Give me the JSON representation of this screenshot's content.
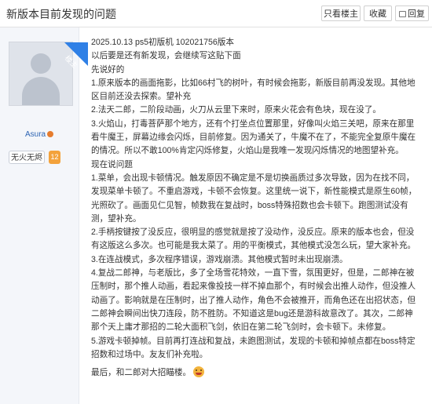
{
  "header": {
    "title": "新版本目前发现的问题",
    "only_op_label": "只看楼主",
    "favorite_label": "收藏",
    "reply_label": "回复"
  },
  "author": {
    "op_badge": "楼主",
    "username": "Asura",
    "title_badge": "无火无烬",
    "level": "12"
  },
  "post": {
    "lines": [
      "2025.10.13 ps5初版机 102021756版本",
      "以后要是还有新发现，会继续写这贴下面",
      "先说好的",
      "1.原来版本的画面拖影，比如66村飞的树叶，有时候会拖影，新版目前再没发现。其他地区目前还没去探索。望补充",
      "2.法天二郎，二阶段动画，火刀从云里下来时，原来火花会有色块，现在没了。",
      "3.火焰山，打毒菩萨那个地方，还有个打坐点位置那里，好像叫火焰三关吧，原来在那里看牛魔王，屏幕边缘会闪烁，目前修复。因为通关了，牛魔不在了，不能完全复原牛魔在的情况。所以不敢100%肯定闪烁修复，火焰山是我唯一发现闪烁情况的地图望补充。",
      "现在说问题",
      "1.菜单，会出现卡顿情况。触发原因不确定是不是切换画质过多次导致，因为在找不同，发现菜单卡顿了。不重启游戏，卡顿不会恢复。这里统一说下，新性能模式是原生60帧，光照砍了。画面见仁见智，帧数我在复战时，boss特殊招数也会卡顿下。跑图测试没有测，望补充。",
      "2.手柄按键按了没反应，很明显的感觉就是按了没动作，没反应。原来的版本也会，但没有这版这么多次。也可能是我太菜了。用的平衡模式，其他模式没怎么玩，望大家补充。",
      "3.在连战模式，多次程序错误，游戏崩溃。其他模式暂时未出现崩溃。",
      "4.复战二郎神，与老版比，多了全场雪花特效，一直下雪，氛围更好，但是，二郎神在被压制时，那个推人动画，看起来像投技一样不掉血那个，有时候会出推人动作，但没推人动画了。影响就是在压制时，出了推人动作，角色不会被推开，而角色还在出招状态，但二郎神会瞬间出快刀连段，防不胜防。不知道这是bug还是游科故意改了。其次，二郎神那个天上庸才那招的二轮大面积飞剑，依旧在第二轮飞剑时，会卡顿下。未修复。",
      "5.游戏卡顿掉帧。目前再打连战和复战，未跑图测试，发现的卡顿和掉帧点都在boss特定招数和过场中。友友们补充啦。",
      "最后，和二郎对大招瞄楼。"
    ]
  }
}
